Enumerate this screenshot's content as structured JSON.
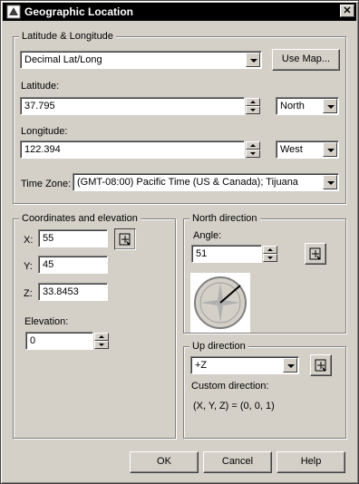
{
  "window": {
    "title": "Geographic Location",
    "close_glyph": "✕"
  },
  "latlong": {
    "group_label": "Latitude & Longitude",
    "format": "Decimal Lat/Long",
    "use_map_label": "Use Map...",
    "latitude_label": "Latitude:",
    "latitude_value": "37.795",
    "latitude_dir": "North",
    "longitude_label": "Longitude:",
    "longitude_value": "122.394",
    "longitude_dir": "West",
    "timezone_label": "Time Zone:",
    "timezone_value": "(GMT-08:00) Pacific Time (US & Canada); Tijuana"
  },
  "coords": {
    "group_label": "Coordinates and elevation",
    "x_label": "X:",
    "x_value": "55",
    "y_label": "Y:",
    "y_value": "45",
    "z_label": "Z:",
    "z_value": "33.8453",
    "elevation_label": "Elevation:",
    "elevation_value": "0"
  },
  "north": {
    "group_label": "North direction",
    "angle_label": "Angle:",
    "angle_value": "51"
  },
  "up": {
    "group_label": "Up direction",
    "value": "+Z",
    "custom_label": "Custom direction:",
    "custom_value": "(X, Y, Z) = (0, 0, 1)"
  },
  "buttons": {
    "ok": "OK",
    "cancel": "Cancel",
    "help": "Help"
  },
  "icons": {
    "app": "app-icon",
    "pick": "pick-point-icon",
    "compass": "compass-icon"
  },
  "colors": {
    "titlebar": "#000000",
    "face": "#d4d0c8",
    "compass_needle": "#000000"
  }
}
